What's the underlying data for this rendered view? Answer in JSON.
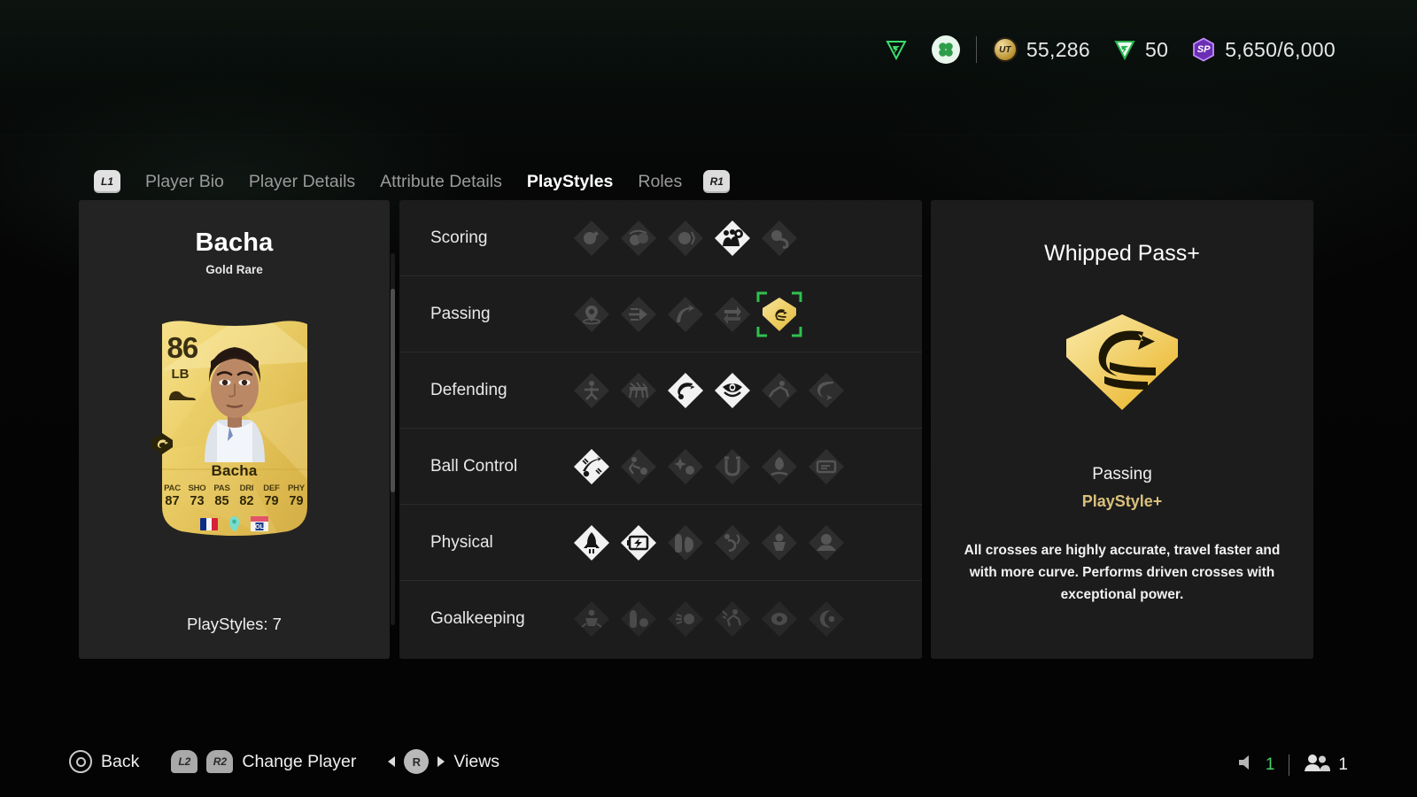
{
  "topbar": {
    "icons": [
      {
        "name": "evolution-triangle-icon",
        "label": "evolution"
      },
      {
        "name": "clover-icon",
        "label": "clover"
      }
    ],
    "currencies": [
      {
        "icon": "ut-coin-icon",
        "icon_label": "UT",
        "value": "55,286"
      },
      {
        "icon": "fc-points-icon",
        "icon_label": "FC",
        "value": "50"
      },
      {
        "icon": "season-points-icon",
        "icon_label": "SP",
        "value": "5,650/6,000"
      }
    ]
  },
  "tabs": {
    "left_bumper": "L1",
    "right_bumper": "R1",
    "items": [
      {
        "label": "Player Bio",
        "active": false
      },
      {
        "label": "Player Details",
        "active": false
      },
      {
        "label": "Attribute Details",
        "active": false
      },
      {
        "label": "PlayStyles",
        "active": true
      },
      {
        "label": "Roles",
        "active": false
      }
    ]
  },
  "player": {
    "name": "Bacha",
    "rarity": "Gold Rare",
    "playstyles_count_label": "PlayStyles: 7",
    "card": {
      "rating": "86",
      "position": "LB",
      "name": "Bacha",
      "stats": [
        {
          "label": "PAC",
          "value": "87"
        },
        {
          "label": "SHO",
          "value": "73"
        },
        {
          "label": "PAS",
          "value": "85"
        },
        {
          "label": "DRI",
          "value": "82"
        },
        {
          "label": "DEF",
          "value": "79"
        },
        {
          "label": "PHY",
          "value": "79"
        }
      ],
      "nation_badge": "france-flag-icon",
      "league_badge": "league-badge-icon",
      "club_badge": "olympique-lyonnais-badge-icon"
    }
  },
  "playstyle_groups": [
    {
      "label": "Scoring",
      "icons": [
        {
          "name": "finesse-shot-icon",
          "state": "inactive"
        },
        {
          "name": "chip-shot-icon",
          "state": "inactive"
        },
        {
          "name": "power-shot-icon",
          "state": "inactive"
        },
        {
          "name": "dead-ball-icon",
          "state": "active"
        },
        {
          "name": "power-header-icon",
          "state": "inactive"
        }
      ]
    },
    {
      "label": "Passing",
      "icons": [
        {
          "name": "pinged-pass-icon",
          "state": "inactive"
        },
        {
          "name": "incisive-pass-icon",
          "state": "inactive"
        },
        {
          "name": "long-ball-pass-icon",
          "state": "inactive"
        },
        {
          "name": "tiki-taka-icon",
          "state": "inactive"
        },
        {
          "name": "whipped-pass-plus-icon",
          "state": "selected"
        }
      ]
    },
    {
      "label": "Defending",
      "icons": [
        {
          "name": "block-icon",
          "state": "inactive"
        },
        {
          "name": "bruiser-icon",
          "state": "inactive"
        },
        {
          "name": "intercept-icon",
          "state": "active"
        },
        {
          "name": "anticipate-icon",
          "state": "active"
        },
        {
          "name": "slide-tackle-icon",
          "state": "inactive"
        },
        {
          "name": "jockey-icon",
          "state": "inactive"
        }
      ]
    },
    {
      "label": "Ball Control",
      "icons": [
        {
          "name": "first-touch-icon",
          "state": "active"
        },
        {
          "name": "flair-icon",
          "state": "inactive"
        },
        {
          "name": "press-proven-icon",
          "state": "inactive"
        },
        {
          "name": "rapid-icon",
          "state": "inactive"
        },
        {
          "name": "technical-icon",
          "state": "inactive"
        },
        {
          "name": "trickster-icon",
          "state": "inactive"
        }
      ]
    },
    {
      "label": "Physical",
      "icons": [
        {
          "name": "acrobatic-icon",
          "state": "active"
        },
        {
          "name": "quick-step-icon",
          "state": "active"
        },
        {
          "name": "relentless-icon",
          "state": "inactive"
        },
        {
          "name": "trivela-icon",
          "state": "inactive"
        },
        {
          "name": "long-throw-icon",
          "state": "inactive"
        },
        {
          "name": "aerial-icon",
          "state": "inactive"
        }
      ]
    },
    {
      "label": "Goalkeeping",
      "icons": [
        {
          "name": "footwork-icon",
          "state": "inactive"
        },
        {
          "name": "cross-claimer-icon",
          "state": "inactive"
        },
        {
          "name": "rush-out-icon",
          "state": "inactive"
        },
        {
          "name": "far-reach-icon",
          "state": "inactive"
        },
        {
          "name": "far-throw-icon",
          "state": "inactive"
        },
        {
          "name": "deflector-icon",
          "state": "inactive"
        }
      ]
    }
  ],
  "detail": {
    "title": "Whipped Pass+",
    "icon": "whipped-pass-plus-large-icon",
    "category": "Passing",
    "kind": "PlayStyle+",
    "description": "All crosses are highly accurate, travel faster and with more curve. Performs driven crosses with exceptional power.",
    "accent_color": "#d9c07b"
  },
  "bottombar": {
    "actions": [
      {
        "button": "circle-button-icon",
        "label": "Back"
      },
      {
        "button": "L2",
        "button2": "R2",
        "label": "Change Player"
      },
      {
        "button": "R",
        "label": "Views"
      }
    ],
    "audio_indicator": "1",
    "players_indicator": "1"
  },
  "colors": {
    "panel_bg": "#1c1c1c",
    "left_panel_bg": "#232323",
    "gold": "#e9c14b",
    "green_select": "#2fc14f"
  }
}
